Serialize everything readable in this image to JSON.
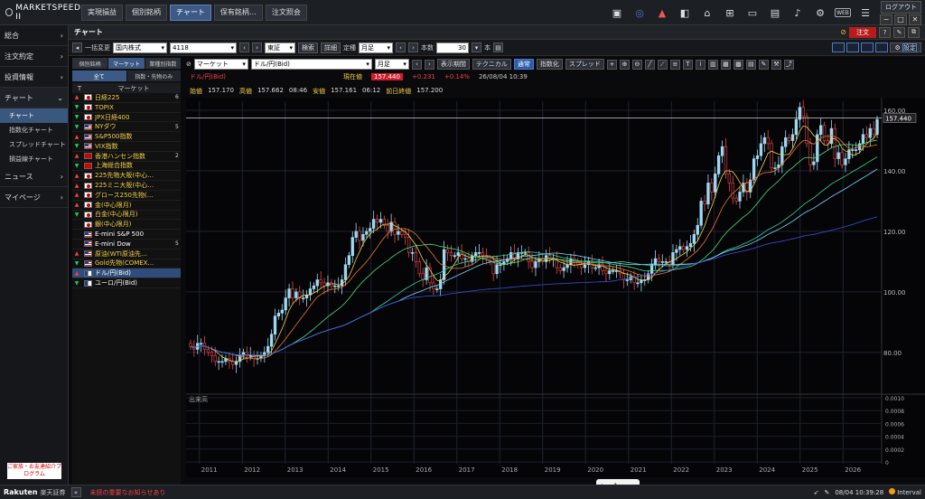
{
  "app": {
    "logo": "MARKETSPEED II",
    "top_tabs": [
      "実現損益",
      "個別銘柄",
      "チャート",
      "保有銘柄…",
      "注文照会"
    ],
    "active_tab": "チャート",
    "logout": "ログアウト",
    "web": "WEB"
  },
  "nav": {
    "items": [
      {
        "label": "総合"
      },
      {
        "label": "注文約定"
      },
      {
        "label": "投資情報"
      },
      {
        "label": "チャート"
      }
    ],
    "sub": [
      "チャート",
      "指数化チャート",
      "スプレッドチャート",
      "損益線チャート"
    ],
    "items2": [
      {
        "label": "ニュース"
      },
      {
        "label": "マイページ"
      }
    ],
    "promo": "ご家族・お友達紹介プログラム"
  },
  "chart_header": {
    "title": "チャート",
    "order": "注文"
  },
  "toolbar1": {
    "batch": "一括変更",
    "market": "国内株式",
    "code": "4118",
    "exchange": "東証",
    "search": "検索",
    "detail": "詳細",
    "fixed": "定種",
    "period": "月足",
    "count_label": "本数",
    "count": "30",
    "unit": "本",
    "settings": "設定"
  },
  "market_panel": {
    "tabs1": [
      "個別銘柄",
      "マーケット",
      "業種別指数"
    ],
    "tabs2": [
      "全て",
      "指数・先物のみ"
    ],
    "header_t": "T",
    "header_name": "マーケット",
    "rows": [
      {
        "dir": "up",
        "flag": "jp",
        "name": "日経225",
        "val": "6"
      },
      {
        "dir": "dn",
        "flag": "jp",
        "name": "TOPIX",
        "val": ""
      },
      {
        "dir": "dn",
        "flag": "jp",
        "name": "JPX日経400",
        "val": ""
      },
      {
        "dir": "dn",
        "flag": "us",
        "name": "NYダウ",
        "val": "5"
      },
      {
        "dir": "up",
        "flag": "us",
        "name": "S&P500指数",
        "val": ""
      },
      {
        "dir": "dn",
        "flag": "us",
        "name": "VIX指数",
        "val": ""
      },
      {
        "dir": "up",
        "flag": "hk",
        "name": "香港ハンセン指数",
        "val": "2"
      },
      {
        "dir": "dn",
        "flag": "cn",
        "name": "上海総合指数",
        "val": ""
      },
      {
        "dir": "up",
        "flag": "jp",
        "name": "225先物大阪(中心…",
        "val": ""
      },
      {
        "dir": "up",
        "flag": "jp",
        "name": "225ミニ大阪(中心…",
        "val": ""
      },
      {
        "dir": "up",
        "flag": "jp",
        "name": "グロース250先物(…",
        "val": ""
      },
      {
        "dir": "up",
        "flag": "jp",
        "name": "金(中心限月)",
        "val": ""
      },
      {
        "dir": "dn",
        "flag": "jp",
        "name": "白金(中心限月)",
        "val": ""
      },
      {
        "dir": "",
        "flag": "jp",
        "name": "銀(中心限月)",
        "val": ""
      },
      {
        "dir": "",
        "flag": "us",
        "name": "E-mini S&P 500",
        "val": ""
      },
      {
        "dir": "",
        "flag": "us",
        "name": "E-mini Dow",
        "val": "5"
      },
      {
        "dir": "up",
        "flag": "us",
        "name": "原油(WTI原油先…",
        "val": ""
      },
      {
        "dir": "dn",
        "flag": "us",
        "name": "Gold先物(COMEX…",
        "val": ""
      },
      {
        "dir": "up",
        "flag": "pair",
        "name": "ドル/円(Bid)",
        "val": ""
      },
      {
        "dir": "dn",
        "flag": "pair",
        "name": "ユーロ/円(Bid)",
        "val": ""
      }
    ]
  },
  "toolbar2": {
    "market": "マーケット",
    "symbol": "ドル/円(Bid)",
    "period": "月足",
    "display_period": "表示期間",
    "technical": "テクニカル",
    "normal": "通常",
    "indexed": "指数化",
    "spread": "スプレッド"
  },
  "info": {
    "pair": "ドル/円(Bid)",
    "current_label": "現在値",
    "current": "157.440",
    "change": "+0.231",
    "change_pct": "+0.14%",
    "datetime": "26/08/04  10:39",
    "open_label": "始値",
    "open": "157.170",
    "high_label": "高値",
    "high": "157.662",
    "high_time": "08:46",
    "low_label": "安値",
    "low": "157.161",
    "low_time": "06:12",
    "prev_label": "前日終値",
    "prev": "157.200"
  },
  "chart_data": {
    "type": "candlestick",
    "title": "ドル/円(Bid)",
    "period": "monthly",
    "x_ticks": [
      "2011",
      "2012",
      "2013",
      "2014",
      "2015",
      "2016",
      "2017",
      "2018",
      "2019",
      "2020",
      "2021",
      "2022",
      "2023",
      "2024",
      "2025",
      "2026"
    ],
    "y_ticks": [
      "80.00",
      "100.00",
      "120.00",
      "140.00",
      "160.00"
    ],
    "ylim": [
      68,
      163
    ],
    "current_price": 157.44,
    "current_price_label": "157.440",
    "volume_label": "出来高",
    "volume_ticks": [
      "0.0010",
      "0.0008",
      "0.0006",
      "0.0004",
      "0.0002",
      "0"
    ],
    "closes": [
      82,
      81,
      83,
      83,
      81,
      80,
      79,
      77,
      77,
      77,
      78,
      77,
      76,
      77,
      79,
      80,
      79,
      79,
      78,
      78,
      79,
      80,
      82,
      86,
      92,
      93,
      94,
      98,
      101,
      98,
      100,
      98,
      98,
      99,
      101,
      102,
      104,
      103,
      102,
      103,
      102,
      102,
      102,
      104,
      109,
      112,
      118,
      120,
      117,
      119,
      120,
      121,
      124,
      123,
      124,
      122,
      120,
      123,
      119,
      120,
      119,
      118,
      113,
      113,
      110,
      106,
      104,
      108,
      103,
      101,
      101,
      104,
      114,
      113,
      112,
      112,
      113,
      111,
      111,
      110,
      112,
      113,
      113,
      112,
      111,
      110,
      106,
      109,
      109,
      110,
      111,
      113,
      111,
      113,
      113,
      113,
      110,
      108,
      110,
      111,
      110,
      112,
      111,
      111,
      108,
      107,
      108,
      109,
      111,
      110,
      109,
      108,
      109,
      110,
      108,
      108,
      109,
      107,
      106,
      107,
      107,
      107,
      106,
      104,
      104,
      105,
      103,
      103,
      104,
      104,
      106,
      109,
      111,
      110,
      110,
      110,
      109,
      113,
      114,
      115,
      114,
      115,
      116,
      119,
      122,
      130,
      129,
      136,
      133,
      139,
      145,
      148,
      139,
      136,
      131,
      130,
      133,
      136,
      133,
      137,
      144,
      145,
      149,
      151,
      149,
      141,
      141,
      142,
      148,
      151,
      150,
      152,
      157,
      161,
      158,
      149,
      142,
      143,
      152,
      155,
      150,
      149,
      154,
      144,
      146,
      142,
      144,
      147,
      147,
      147,
      149,
      152,
      151,
      154,
      152,
      157
    ]
  },
  "status": {
    "brand": "Rakuten",
    "brand2": "楽天証券",
    "alert": "未読の重要なお知らせあり",
    "datetime": "08/04 10:39:28",
    "interval": "Interval"
  }
}
